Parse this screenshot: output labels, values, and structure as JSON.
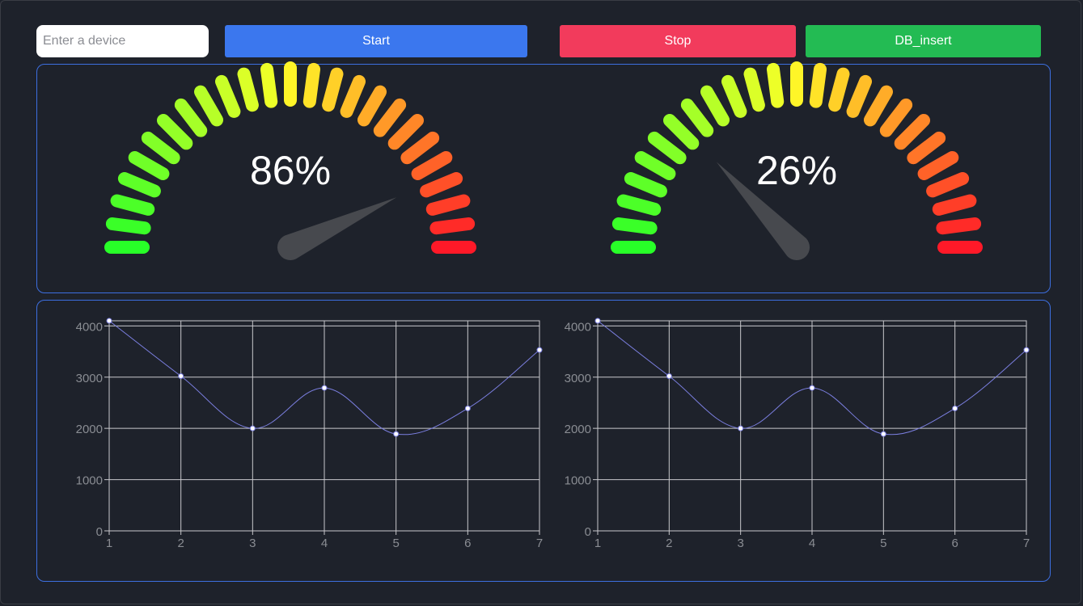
{
  "toolbar": {
    "device_placeholder": "Enter a device",
    "device_value": "",
    "start_label": "Start",
    "stop_label": "Stop",
    "db_insert_label": "DB_insert",
    "colors": {
      "start": "#3b77ee",
      "stop": "#f23b5c",
      "db_insert": "#23bb53"
    }
  },
  "gauges": [
    {
      "value": 86,
      "label": "86%"
    },
    {
      "value": 26,
      "label": "26%"
    }
  ],
  "chart_data": [
    {
      "type": "line",
      "x": [
        1,
        2,
        3,
        4,
        5,
        6,
        7
      ],
      "series": [
        {
          "values": [
            4100,
            3020,
            2000,
            2790,
            1890,
            2390,
            3530
          ],
          "color": "#7b7fe0"
        }
      ],
      "xlim": [
        1,
        7
      ],
      "ylim": [
        0,
        4100
      ],
      "yticks": [
        0,
        1000,
        2000,
        3000,
        4000
      ],
      "xticks": [
        1,
        2,
        3,
        4,
        5,
        6,
        7
      ],
      "smooth": true,
      "grid": true
    },
    {
      "type": "line",
      "x": [
        1,
        2,
        3,
        4,
        5,
        6,
        7
      ],
      "series": [
        {
          "values": [
            4100,
            3020,
            2000,
            2790,
            1890,
            2390,
            3530
          ],
          "color": "#7b7fe0"
        }
      ],
      "xlim": [
        1,
        7
      ],
      "ylim": [
        0,
        4100
      ],
      "yticks": [
        0,
        1000,
        2000,
        3000,
        4000
      ],
      "xticks": [
        1,
        2,
        3,
        4,
        5,
        6,
        7
      ],
      "smooth": true,
      "grid": true
    }
  ]
}
